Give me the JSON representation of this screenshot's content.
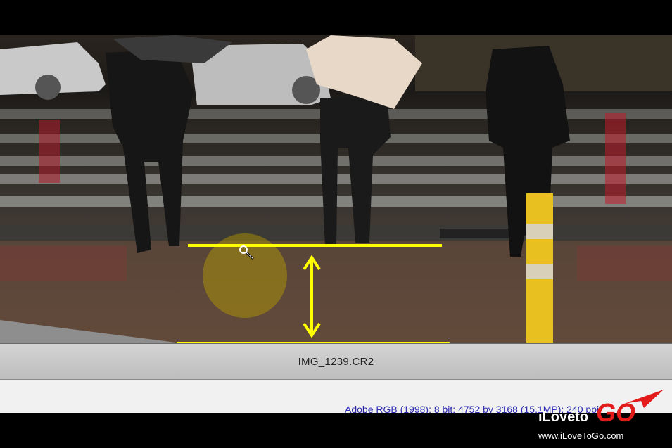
{
  "viewer": {
    "filename": "IMG_1239.CR2",
    "color_info": "Adobe RGB (1998); 8 bit; 4752 by 3168 (15.1MP); 240 ppi"
  },
  "watermark": {
    "brand_prefix": "iLoveto",
    "brand_suffix": "GO",
    "url": "www.iLoveToGo.com"
  },
  "colors": {
    "annotation": "#ffff00",
    "info_text": "#2a2ab0",
    "logo_red": "#e21b1b"
  }
}
